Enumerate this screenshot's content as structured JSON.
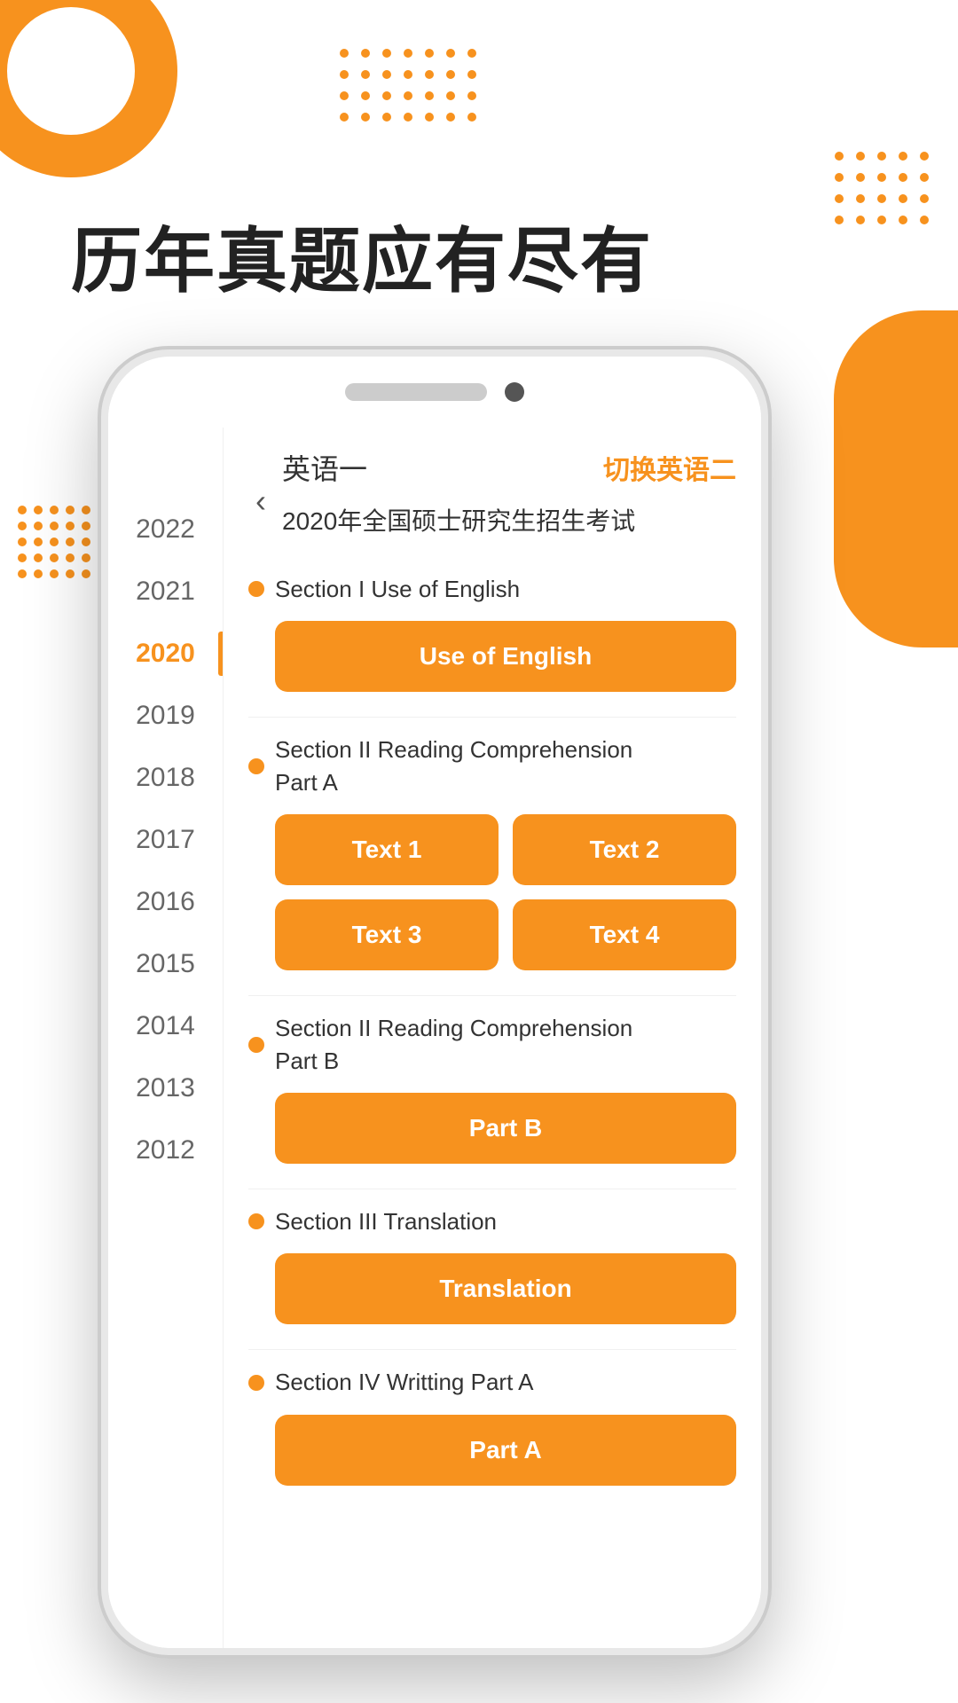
{
  "page": {
    "hero_title": "历年真题应有尽有"
  },
  "phone": {
    "header": {
      "back_icon": "‹",
      "section_title": "英语一",
      "switch_label": "切换英语二",
      "exam_title": "2020年全国硕士研究生招生考试"
    },
    "years": [
      {
        "label": "2022",
        "active": false
      },
      {
        "label": "2021",
        "active": false
      },
      {
        "label": "2020",
        "active": true
      },
      {
        "label": "2019",
        "active": false
      },
      {
        "label": "2018",
        "active": false
      },
      {
        "label": "2017",
        "active": false
      },
      {
        "label": "2016",
        "active": false
      },
      {
        "label": "2015",
        "active": false
      },
      {
        "label": "2014",
        "active": false
      },
      {
        "label": "2013",
        "active": false
      },
      {
        "label": "2012",
        "active": false
      }
    ],
    "sections": [
      {
        "id": "section1",
        "label": "Section I Use of English",
        "buttons": [
          "Use of English"
        ]
      },
      {
        "id": "section2",
        "label": "Section II Reading Comprehension Part A",
        "buttons": [
          "Text 1",
          "Text 2",
          "Text 3",
          "Text 4"
        ]
      },
      {
        "id": "section3",
        "label": "Section II Reading Comprehension Part B",
        "buttons": [
          "Part B"
        ]
      },
      {
        "id": "section4",
        "label": "Section III Translation",
        "buttons": [
          "Translation"
        ]
      },
      {
        "id": "section5",
        "label": "Section IV Writting Part A",
        "buttons": [
          "Part A"
        ]
      }
    ]
  }
}
